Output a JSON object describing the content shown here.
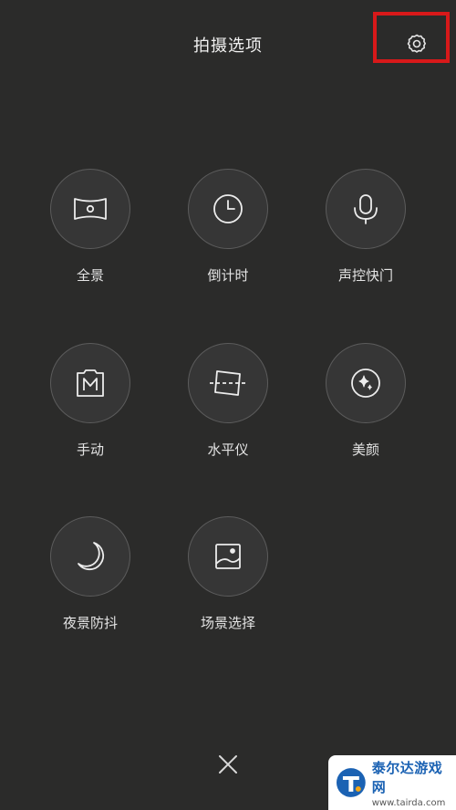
{
  "header": {
    "title": "拍摄选项",
    "settings_icon": "gear-icon"
  },
  "options": [
    {
      "label": "全景",
      "icon": "panorama-icon"
    },
    {
      "label": "倒计时",
      "icon": "clock-icon"
    },
    {
      "label": "声控快门",
      "icon": "microphone-icon"
    },
    {
      "label": "手动",
      "icon": "manual-m-icon"
    },
    {
      "label": "水平仪",
      "icon": "level-icon"
    },
    {
      "label": "美颜",
      "icon": "sparkle-icon"
    },
    {
      "label": "夜景防抖",
      "icon": "moon-icon"
    },
    {
      "label": "场景选择",
      "icon": "scene-image-icon"
    }
  ],
  "footer": {
    "close_icon": "close-icon"
  },
  "watermark": {
    "title": "泰尔达游戏网",
    "url": "www.tairda.com"
  },
  "colors": {
    "background": "#2b2b2a",
    "circle_fill": "#363636",
    "circle_border": "#5c5c5c",
    "highlight": "#d8191a",
    "watermark_blue": "#1b62b3"
  }
}
